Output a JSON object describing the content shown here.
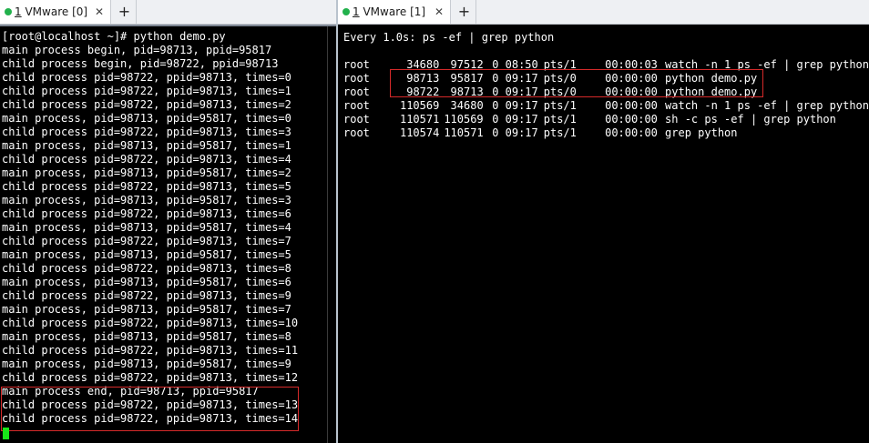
{
  "left": {
    "tab": {
      "number": "1",
      "title": "VMware [0]",
      "close": "✕"
    },
    "add_tab": "+",
    "nav": {
      "prev": "◀",
      "next": "▶",
      "menu": "▾"
    },
    "lines": [
      "[root@localhost ~]# python demo.py",
      "main process begin, pid=98713, ppid=95817",
      "child process begin, pid=98722, ppid=98713",
      "child process pid=98722, ppid=98713, times=0",
      "child process pid=98722, ppid=98713, times=1",
      "child process pid=98722, ppid=98713, times=2",
      "main process, pid=98713, ppid=95817, times=0",
      "child process pid=98722, ppid=98713, times=3",
      "main process, pid=98713, ppid=95817, times=1",
      "child process pid=98722, ppid=98713, times=4",
      "main process, pid=98713, ppid=95817, times=2",
      "child process pid=98722, ppid=98713, times=5",
      "main process, pid=98713, ppid=95817, times=3",
      "child process pid=98722, ppid=98713, times=6",
      "main process, pid=98713, ppid=95817, times=4",
      "child process pid=98722, ppid=98713, times=7",
      "main process, pid=98713, ppid=95817, times=5",
      "child process pid=98722, ppid=98713, times=8",
      "main process, pid=98713, ppid=95817, times=6",
      "child process pid=98722, ppid=98713, times=9",
      "main process, pid=98713, ppid=95817, times=7",
      "child process pid=98722, ppid=98713, times=10",
      "main process, pid=98713, ppid=95817, times=8",
      "child process pid=98722, ppid=98713, times=11",
      "main process, pid=98713, ppid=95817, times=9",
      "child process pid=98722, ppid=98713, times=12",
      "main process end, pid=98713, ppid=95817",
      "child process pid=98722, ppid=98713, times=13",
      "child process pid=98722, ppid=98713, times=14"
    ]
  },
  "right": {
    "tab": {
      "number": "1",
      "title": "VMware [1]",
      "close": "✕"
    },
    "add_tab": "+",
    "watch_header": "Every 1.0s: ps -ef | grep python",
    "processes": [
      {
        "user": "root",
        "pid": "34680",
        "ppid": "97512",
        "c": "0",
        "stime": "08:50",
        "tty": "pts/1",
        "time": "00:00:03",
        "cmd": "watch -n 1 ps -ef | grep python"
      },
      {
        "user": "root",
        "pid": "98713",
        "ppid": "95817",
        "c": "0",
        "stime": "09:17",
        "tty": "pts/0",
        "time": "00:00:00",
        "cmd": "python demo.py"
      },
      {
        "user": "root",
        "pid": "98722",
        "ppid": "98713",
        "c": "0",
        "stime": "09:17",
        "tty": "pts/0",
        "time": "00:00:00",
        "cmd": "python demo.py"
      },
      {
        "user": "root",
        "pid": "110569",
        "ppid": "34680",
        "c": "0",
        "stime": "09:17",
        "tty": "pts/1",
        "time": "00:00:00",
        "cmd": "watch -n 1 ps -ef | grep python"
      },
      {
        "user": "root",
        "pid": "110571",
        "ppid": "110569",
        "c": "0",
        "stime": "09:17",
        "tty": "pts/1",
        "time": "00:00:00",
        "cmd": "sh -c ps -ef | grep python"
      },
      {
        "user": "root",
        "pid": "110574",
        "ppid": "110571",
        "c": "0",
        "stime": "09:17",
        "tty": "pts/1",
        "time": "00:00:00",
        "cmd": "grep python"
      }
    ]
  },
  "colors": {
    "terminal_bg": "#000000",
    "terminal_fg": "#ffffff",
    "highlight_border": "#d62a2a",
    "cursor": "#19e619",
    "tab_status": "#22b14c"
  }
}
